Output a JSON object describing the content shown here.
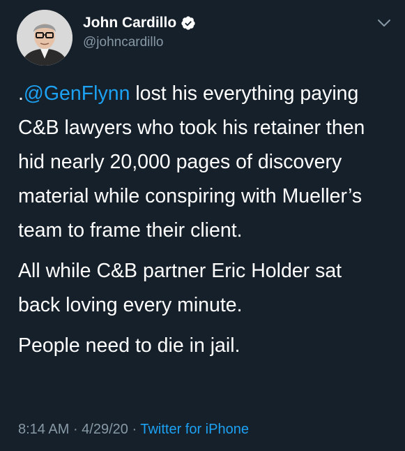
{
  "author": {
    "display_name": "John Cardillo",
    "handle": "@johncardillo",
    "verified": true,
    "avatar_icon": "avatar-photo"
  },
  "tweet": {
    "paragraphs": [
      {
        "prefix": ".",
        "mention": "@GenFlynn",
        "text": " lost his everything paying C&B lawyers who took his retainer then hid nearly 20,000 pages of discovery material while conspiring with Mueller’s team to frame their client."
      },
      {
        "text": "All while C&B partner Eric Holder sat back loving every minute."
      },
      {
        "text": "People need to die in jail."
      }
    ]
  },
  "meta": {
    "time": "8:14 AM",
    "separator": " · ",
    "date": "4/29/20",
    "source": "Twitter for iPhone"
  },
  "colors": {
    "background": "#15202b",
    "accent": "#1da1f2",
    "secondary_text": "#8899a6"
  },
  "icons": {
    "verified": "verified-badge-icon",
    "menu": "chevron-down-icon"
  }
}
